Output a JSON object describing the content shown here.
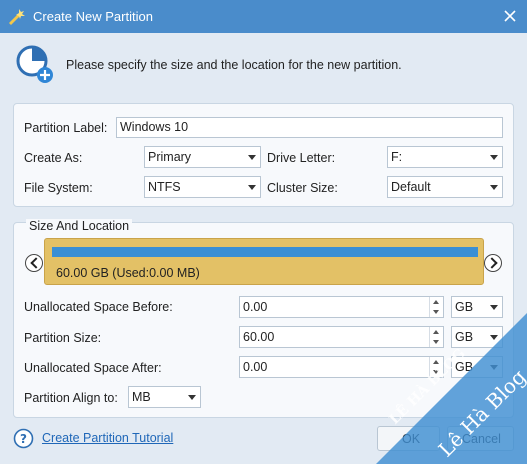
{
  "window": {
    "title": "Create New Partition"
  },
  "header": {
    "instruction": "Please specify the size and the location for the new partition."
  },
  "general": {
    "partition_label_label": "Partition Label:",
    "partition_label_value": "Windows 10",
    "create_as_label": "Create As:",
    "create_as_value": "Primary",
    "drive_letter_label": "Drive Letter:",
    "drive_letter_value": "F:",
    "file_system_label": "File System:",
    "file_system_value": "NTFS",
    "cluster_size_label": "Cluster Size:",
    "cluster_size_value": "Default"
  },
  "size_location": {
    "group_title": "Size And Location",
    "disk_info": "60.00 GB (Used:0.00 MB)",
    "unallocated_before_label": "Unallocated Space Before:",
    "unallocated_before_value": "0.00",
    "unallocated_before_unit": "GB",
    "partition_size_label": "Partition Size:",
    "partition_size_value": "60.00",
    "partition_size_unit": "GB",
    "unallocated_after_label": "Unallocated Space After:",
    "unallocated_after_value": "0.00",
    "unallocated_after_unit": "GB",
    "align_label": "Partition Align to:",
    "align_value": "MB"
  },
  "footer": {
    "tutorial_link": "Create Partition Tutorial",
    "ok_label": "OK",
    "cancel_label": "Cancel"
  },
  "watermark": {
    "line1": "Lê Hà Blog",
    "line2": "LÊ HÀ BLOG"
  },
  "colors": {
    "titlebar": "#4a8ccb",
    "disk_bar": "#e3c166",
    "disk_stripe": "#3a8fd4",
    "link": "#1f67b8",
    "watermark": "#3f8fd2"
  }
}
